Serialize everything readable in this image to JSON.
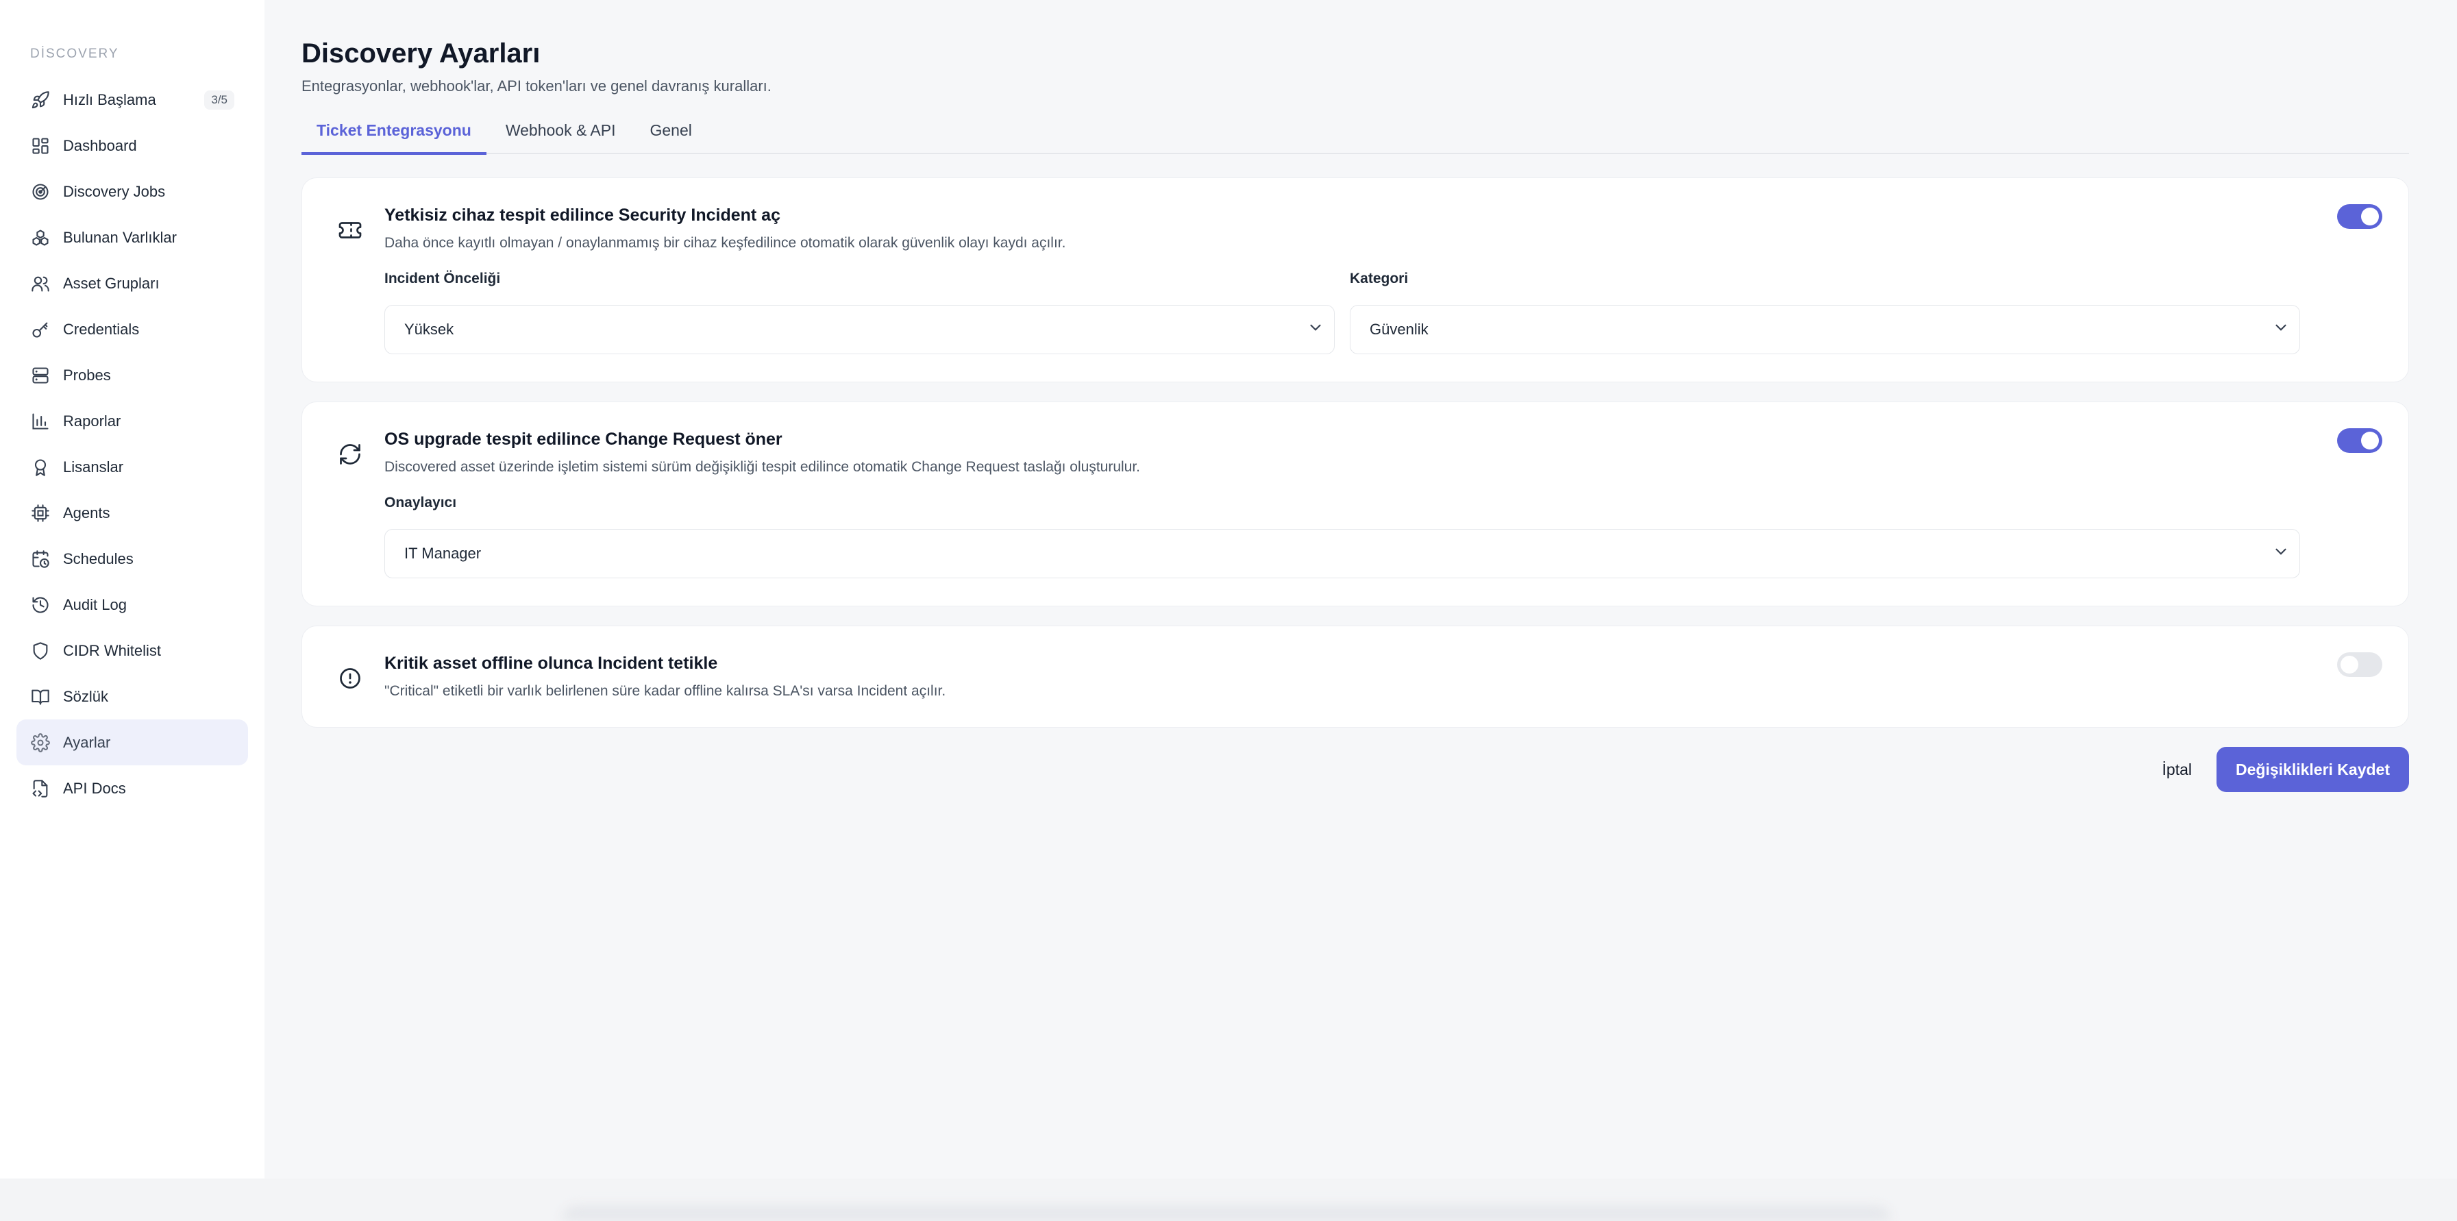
{
  "sidebar": {
    "section": "DİSCOVERY",
    "items": [
      {
        "label": "Hızlı Başlama",
        "icon": "rocket-icon",
        "badge": "3/5"
      },
      {
        "label": "Dashboard",
        "icon": "dashboard-grid-icon"
      },
      {
        "label": "Discovery Jobs",
        "icon": "radar-icon"
      },
      {
        "label": "Bulunan Varlıklar",
        "icon": "boxes-icon"
      },
      {
        "label": "Asset Grupları",
        "icon": "users-icon"
      },
      {
        "label": "Credentials",
        "icon": "key-icon"
      },
      {
        "label": "Probes",
        "icon": "server-icon"
      },
      {
        "label": "Raporlar",
        "icon": "bar-chart-icon"
      },
      {
        "label": "Lisanslar",
        "icon": "award-icon"
      },
      {
        "label": "Agents",
        "icon": "cpu-icon"
      },
      {
        "label": "Schedules",
        "icon": "calendar-clock-icon"
      },
      {
        "label": "Audit Log",
        "icon": "history-icon"
      },
      {
        "label": "CIDR Whitelist",
        "icon": "shield-icon"
      },
      {
        "label": "Sözlük",
        "icon": "book-open-icon"
      },
      {
        "label": "Ayarlar",
        "icon": "gear-icon",
        "active": true
      },
      {
        "label": "API Docs",
        "icon": "file-code-icon"
      }
    ]
  },
  "page": {
    "title": "Discovery Ayarları",
    "subtitle": "Entegrasyonlar, webhook'lar, API token'ları ve genel davranış kuralları."
  },
  "tabs": [
    {
      "label": "Ticket Entegrasyonu",
      "active": true
    },
    {
      "label": "Webhook & API"
    },
    {
      "label": "Genel"
    }
  ],
  "cards": [
    {
      "icon": "ticket-icon",
      "title": "Yetkisiz cihaz tespit edilince Security Incident aç",
      "desc": "Daha önce kayıtlı olmayan / onaylanmamış bir cihaz keşfedilince otomatik olarak güvenlik olayı kaydı açılır.",
      "enabled": true,
      "fields": [
        {
          "label": "Incident Önceliği",
          "value": "Yüksek"
        },
        {
          "label": "Kategori",
          "value": "Güvenlik"
        }
      ]
    },
    {
      "icon": "refresh-icon",
      "title": "OS upgrade tespit edilince Change Request öner",
      "desc": "Discovered asset üzerinde işletim sistemi sürüm değişikliği tespit edilince otomatik Change Request taslağı oluşturulur.",
      "enabled": true,
      "fields": [
        {
          "label": "Onaylayıcı",
          "value": "IT Manager"
        }
      ]
    },
    {
      "icon": "alert-circle-icon",
      "title": "Kritik asset offline olunca Incident tetikle",
      "desc": "\"Critical\" etiketli bir varlık belirlenen süre kadar offline kalırsa SLA'sı varsa Incident açılır.",
      "enabled": false
    }
  ],
  "actions": {
    "cancel": "İptal",
    "save": "Değişiklikleri Kaydet"
  },
  "colors": {
    "accent": "#5b63d8",
    "active_nav_bg": "#eef0fb",
    "main_bg": "#f6f7f9"
  }
}
